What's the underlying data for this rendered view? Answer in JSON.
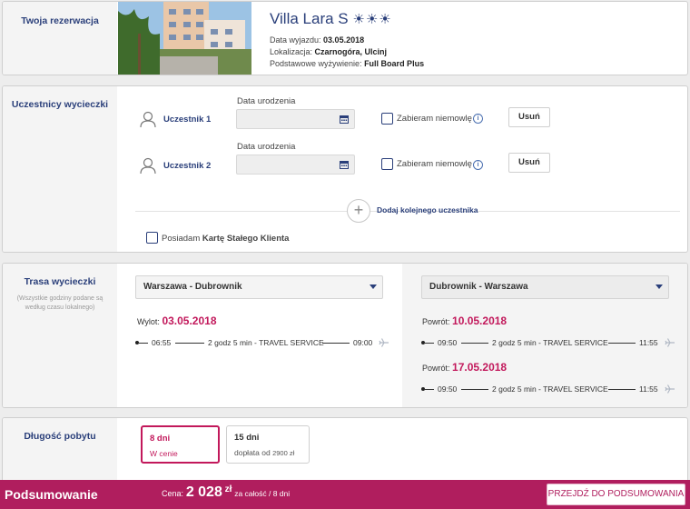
{
  "reservation": {
    "section_title": "Twoja rezerwacja",
    "hotel_name": "Villa Lara S",
    "stars_glyph": "☀☀☀",
    "departure_label": "Data wyjazdu:",
    "departure_value": "03.05.2018",
    "location_label": "Lokalizacja:",
    "location_value": "Czarnogóra, Ulcinj",
    "board_label": "Podstawowe wyżywienie:",
    "board_value": "Full Board Plus"
  },
  "participants": {
    "section_title": "Uczestnicy wycieczki",
    "items": [
      {
        "name": "Uczestnik 1",
        "dob_label": "Data urodzenia",
        "infant_label": "Zabieram niemowlę",
        "remove_label": "Usuń"
      },
      {
        "name": "Uczestnik 2",
        "dob_label": "Data urodzenia",
        "infant_label": "Zabieram niemowlę",
        "remove_label": "Usuń"
      }
    ],
    "add_label": "Dodaj kolejnego uczestnika",
    "loyalty_prefix": "Posiadam",
    "loyalty_bold": "Kartę Stałego Klienta"
  },
  "route": {
    "section_title": "Trasa wycieczki",
    "section_note": "(Wszystkie godziny podane są według czasu lokalnego)",
    "outbound": {
      "select_value": "Warszawa - Dubrownik",
      "date_label": "Wylot:",
      "date": "03.05.2018",
      "dep_time": "06:55",
      "duration": "2 godz 5 min",
      "carrier": "TRAVEL SERVICE",
      "arr_time": "09:00"
    },
    "inbound": {
      "select_value": "Dubrownik - Warszawa",
      "options": [
        {
          "date_label": "Powrót:",
          "date": "10.05.2018",
          "dep_time": "09:50",
          "duration": "2 godz 5 min",
          "carrier": "TRAVEL SERVICE",
          "arr_time": "11:55"
        },
        {
          "date_label": "Powrót:",
          "date": "17.05.2018",
          "dep_time": "09:50",
          "duration": "2 godz 5 min",
          "carrier": "TRAVEL SERVICE",
          "arr_time": "11:55"
        }
      ]
    }
  },
  "duration": {
    "section_title": "Długość pobytu",
    "options": [
      {
        "title": "8 dni",
        "sub": "W cenie"
      },
      {
        "title": "15 dni",
        "sub_prefix": "dopłata od",
        "sub_value": "2900 zł"
      }
    ]
  },
  "summary": {
    "title": "Podsumowanie",
    "price_label": "Cena:",
    "price_value": "2 028",
    "price_currency": "zł",
    "price_note": "za całość / 8 dni",
    "cta_label": "PRZEJDŹ DO PODSUMOWANIA"
  },
  "colors": {
    "brand_navy": "#2a3f7a",
    "brand_magenta": "#b01e5e",
    "accent_date": "#c2185b"
  },
  "icons": [
    "person-icon",
    "calendar-icon",
    "info-icon",
    "plus-icon",
    "plane-icon",
    "sun-icon",
    "caret-down-icon"
  ]
}
